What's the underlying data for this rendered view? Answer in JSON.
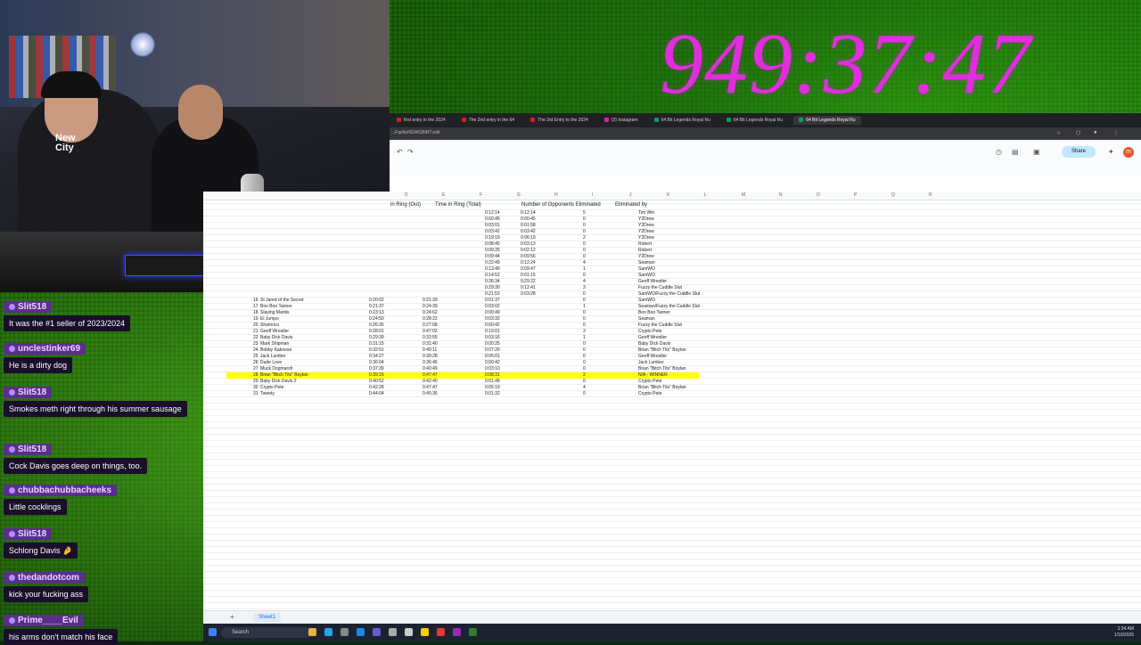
{
  "timer": "949:37:47",
  "webcam": {
    "shirt_text": "New City"
  },
  "browser": {
    "tabs": [
      {
        "label": "first entry in the 2024",
        "color": "#cc2222"
      },
      {
        "label": "The 2nd entry in the 64",
        "color": "#cc2222"
      },
      {
        "label": "The 3rd Entry to the 2024",
        "color": "#cc2222"
      },
      {
        "label": "(3) Instagram",
        "color": "#d6249f"
      },
      {
        "label": "64 Bit Legends Royal Ru",
        "color": "#0f9d58"
      },
      {
        "label": "64 Bit Legends Royal Ru",
        "color": "#0f9d58"
      },
      {
        "label": "64 Bit Legends Royal Ru",
        "color": "#0f9d58"
      }
    ],
    "url": "...Fqx9eNGWGBtRT.edit",
    "share_label": "Share",
    "avatar_letter": "m"
  },
  "sheet": {
    "columns": [
      "D",
      "E",
      "F",
      "G",
      "H",
      "I",
      "J",
      "K",
      "L",
      "M",
      "N",
      "O",
      "P",
      "Q",
      "R"
    ],
    "headers": {
      "d": "in Ring (Out)",
      "e": "Time in Ring (Total)",
      "f": "Number of Opponents Eliminated",
      "g": "Eliminated by"
    },
    "top_rows": [
      [
        "0:12:14",
        "0:12:14",
        "5",
        "Tim Win"
      ],
      [
        "0:00:45",
        "0:00:45",
        "0",
        "Y2Drew"
      ],
      [
        "0:03:01",
        "0:01:58",
        "0",
        "Y2Drew"
      ],
      [
        "0:03:42",
        "0:03:42",
        "0",
        "Y2Drew"
      ],
      [
        "0:19:19",
        "0:06:19",
        "2",
        "Y2Drew"
      ],
      [
        "0:08:45",
        "0:03:13",
        "0",
        "Robert"
      ],
      [
        "0:09:25",
        "0:02:12",
        "0",
        "Robert"
      ],
      [
        "0:09:44",
        "0:09:56",
        "0",
        "Y2Drew"
      ],
      [
        "0:22:49",
        "0:12:24",
        "4",
        "Seaman"
      ],
      [
        "0:13:49",
        "0:09:47",
        "1",
        "SamWO"
      ],
      [
        "0:14:52",
        "0:01:15",
        "0",
        "SamWO"
      ],
      [
        "0:36:34",
        "0:29:22",
        "4",
        "Geoff Wrestler"
      ],
      [
        "0:29:30",
        "0:12:41",
        "3",
        "Fuzzy the Cuddle Slut"
      ],
      [
        "0:21:53",
        "0:03:28",
        "0",
        "SamWO/Fuzzy the Cuddle Slut"
      ]
    ],
    "rows": [
      [
        "16",
        "St Jared of the Secret",
        "0:20:02",
        "0:21:39",
        "0:01:37",
        "0",
        "SamWO"
      ],
      [
        "17",
        "Boo Boo Tanner",
        "0:21:37",
        "0:24:39",
        "0:03:02",
        "1",
        "Seaman/Fuzzy the Cuddle Slut"
      ],
      [
        "18",
        "Slaying Mantis",
        "0:23:13",
        "0:24:62",
        "0:00:49",
        "0",
        "Boo Boo Tanner"
      ],
      [
        "19",
        "El Jumpo",
        "0:24:50",
        "0:28:22",
        "0:03:32",
        "0",
        "Seaman"
      ],
      [
        "20",
        "Shamrico",
        "0:26:26",
        "0:27:08",
        "0:00:42",
        "0",
        "Fuzzy the Cuddle Slut"
      ],
      [
        "21",
        "Geoff Wrestler",
        "0:28:01",
        "0:47:02",
        "0:19:01",
        "3",
        "Crypto Pete"
      ],
      [
        "22",
        "Baby Dick Davis",
        "0:29:39",
        "0:32:55",
        "0:03:16",
        "1",
        "Geoff Wrestler"
      ],
      [
        "23",
        "Mark Shipman",
        "0:31:15",
        "0:31:40",
        "0:00:25",
        "0",
        "Baby Dick Davis"
      ],
      [
        "24",
        "Bobby Kaboose",
        "0:32:51",
        "0:40:11",
        "0:07:20",
        "0",
        "Brian \"Bitch Tits\" Boylan"
      ],
      [
        "25",
        "Jack Lumber",
        "0:34:27",
        "0:39:28",
        "0:05:01",
        "0",
        "Geoff Wrestler"
      ],
      [
        "26",
        "Dude Love",
        "0:36:04",
        "0:36:46",
        "0:00:42",
        "0",
        "Jack Lumber"
      ],
      [
        "27",
        "Muck Dogmarsh",
        "0:37:39",
        "0:40:49",
        "0:03:10",
        "0",
        "Brian \"Bitch Tits\" Boylan"
      ],
      [
        "28",
        "Brian \"Bitch Tits\" Boylan",
        "0:39:16",
        "0:47:47",
        "0:08:31",
        "2",
        "N/A - WINNER"
      ],
      [
        "29",
        "Baby Dick Davis 2",
        "0:40:52",
        "0:42:40",
        "0:01:48",
        "0",
        "Crypto Pete"
      ],
      [
        "30",
        "Crypto Pete",
        "0:42:28",
        "0:47:47",
        "0:05:19",
        "4",
        "Brian \"Bitch Tits\" Boylan"
      ],
      [
        "31",
        "Tweety",
        "0:44:04",
        "0:45:36",
        "0:01:32",
        "0",
        "Crypto Pete"
      ]
    ],
    "tab_name": "Sheet1"
  },
  "taskbar": {
    "search": "Search",
    "time": "1:34 AM",
    "date": "1/10/2026"
  },
  "chat": [
    {
      "user": "Slit518",
      "text": "It was the #1 seller of 2023/2024"
    },
    {
      "user": "unclestinker69",
      "text": "He is a dirty dog"
    },
    {
      "user": "Slit518",
      "text": "Smokes meth right through his summer sausage"
    },
    {
      "user": "Slit518",
      "text": "Cock Davis goes deep on things, too."
    },
    {
      "user": "chubbachubbacheeks",
      "text": "Little cocklings"
    },
    {
      "user": "Slit518",
      "text": "Schlong Davis 🤌"
    },
    {
      "user": "thedandotcom",
      "text": "kick your fucking ass"
    },
    {
      "user": "Prime____Evil",
      "text": "his arms don't match his face"
    }
  ]
}
